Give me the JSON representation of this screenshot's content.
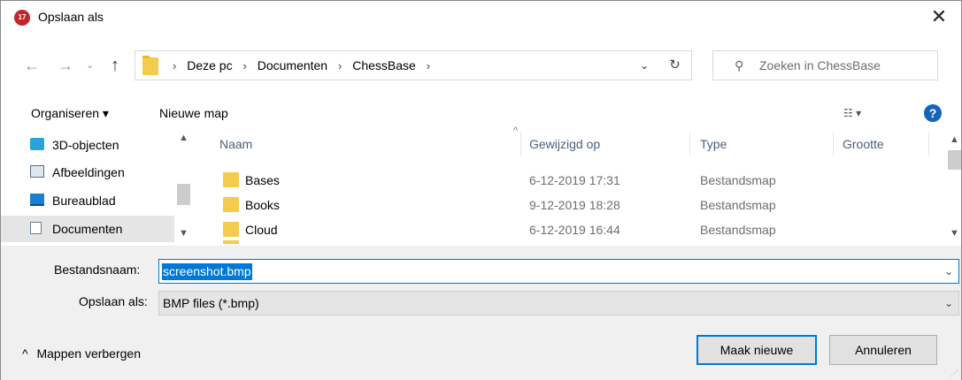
{
  "window": {
    "title": "Opslaan als",
    "app_icon_text": "17",
    "close_glyph": "✕"
  },
  "nav": {
    "back_glyph": "←",
    "forward_glyph": "→",
    "recent_glyph": "⌄",
    "up_glyph": "↑",
    "breadcrumb": [
      "Deze pc",
      "Documenten",
      "ChessBase"
    ],
    "crumb_sep": "›",
    "dropdown_glyph": "⌄",
    "refresh_glyph": "↻",
    "search_icon": "⚲",
    "search_placeholder": "Zoeken in ChessBase"
  },
  "toolbar": {
    "organize_label": "Organiseren ▾",
    "new_folder_label": "Nieuwe map",
    "view_glyph": "☷ ▾",
    "help_glyph": "?"
  },
  "sidebar": {
    "items": [
      {
        "label": "3D-objecten",
        "icon": "3d-objects-icon",
        "selected": false
      },
      {
        "label": "Afbeeldingen",
        "icon": "pictures-icon",
        "selected": false
      },
      {
        "label": "Bureaublad",
        "icon": "desktop-icon",
        "selected": false
      },
      {
        "label": "Documenten",
        "icon": "documents-icon",
        "selected": true
      }
    ]
  },
  "files": {
    "columns": [
      "Naam",
      "Gewijzigd op",
      "Type",
      "Grootte"
    ],
    "sort_glyph": "^",
    "rows": [
      {
        "name": "Bases",
        "modified": "6-12-2019 17:31",
        "type": "Bestandsmap",
        "size": ""
      },
      {
        "name": "Books",
        "modified": "9-12-2019 18:28",
        "type": "Bestandsmap",
        "size": ""
      },
      {
        "name": "Cloud",
        "modified": "6-12-2019 16:44",
        "type": "Bestandsmap",
        "size": ""
      }
    ]
  },
  "form": {
    "filename_label": "Bestandsnaam:",
    "filename_value": "screenshot.bmp",
    "filetype_label": "Opslaan als:",
    "filetype_value": "BMP files (*.bmp)",
    "dropdown_glyph": "⌄"
  },
  "actions": {
    "save_label": "Maak nieuwe",
    "cancel_label": "Annuleren",
    "toggle_glyph": "^",
    "toggle_label": "Mappen verbergen"
  },
  "colors": {
    "accent": "#0078d7",
    "folder": "#f5cb4d",
    "selected_row": "#e5e5e5",
    "header_text": "#4c607a"
  }
}
